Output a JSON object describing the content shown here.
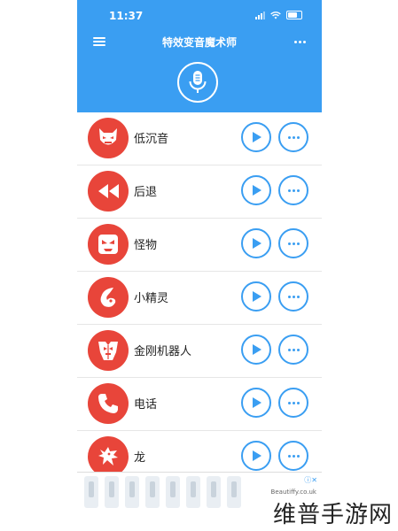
{
  "status": {
    "time": "11:37"
  },
  "header": {
    "title": "特效变音魔术师"
  },
  "effects": [
    {
      "label": "低沉音",
      "icon": "demon-mask-icon"
    },
    {
      "label": "后退",
      "icon": "rewind-icon"
    },
    {
      "label": "怪物",
      "icon": "monster-face-icon"
    },
    {
      "label": "小精灵",
      "icon": "sprite-head-icon"
    },
    {
      "label": "金刚机器人",
      "icon": "robot-emblem-icon"
    },
    {
      "label": "电话",
      "icon": "phone-icon"
    },
    {
      "label": "龙",
      "icon": "dragon-head-icon"
    }
  ],
  "ad": {
    "site": "Beautiffy.co.uk"
  },
  "watermark": "维普手游网",
  "colors": {
    "header": "#3a9ef2",
    "avatar": "#e8453a",
    "accent": "#3a9ef2"
  }
}
